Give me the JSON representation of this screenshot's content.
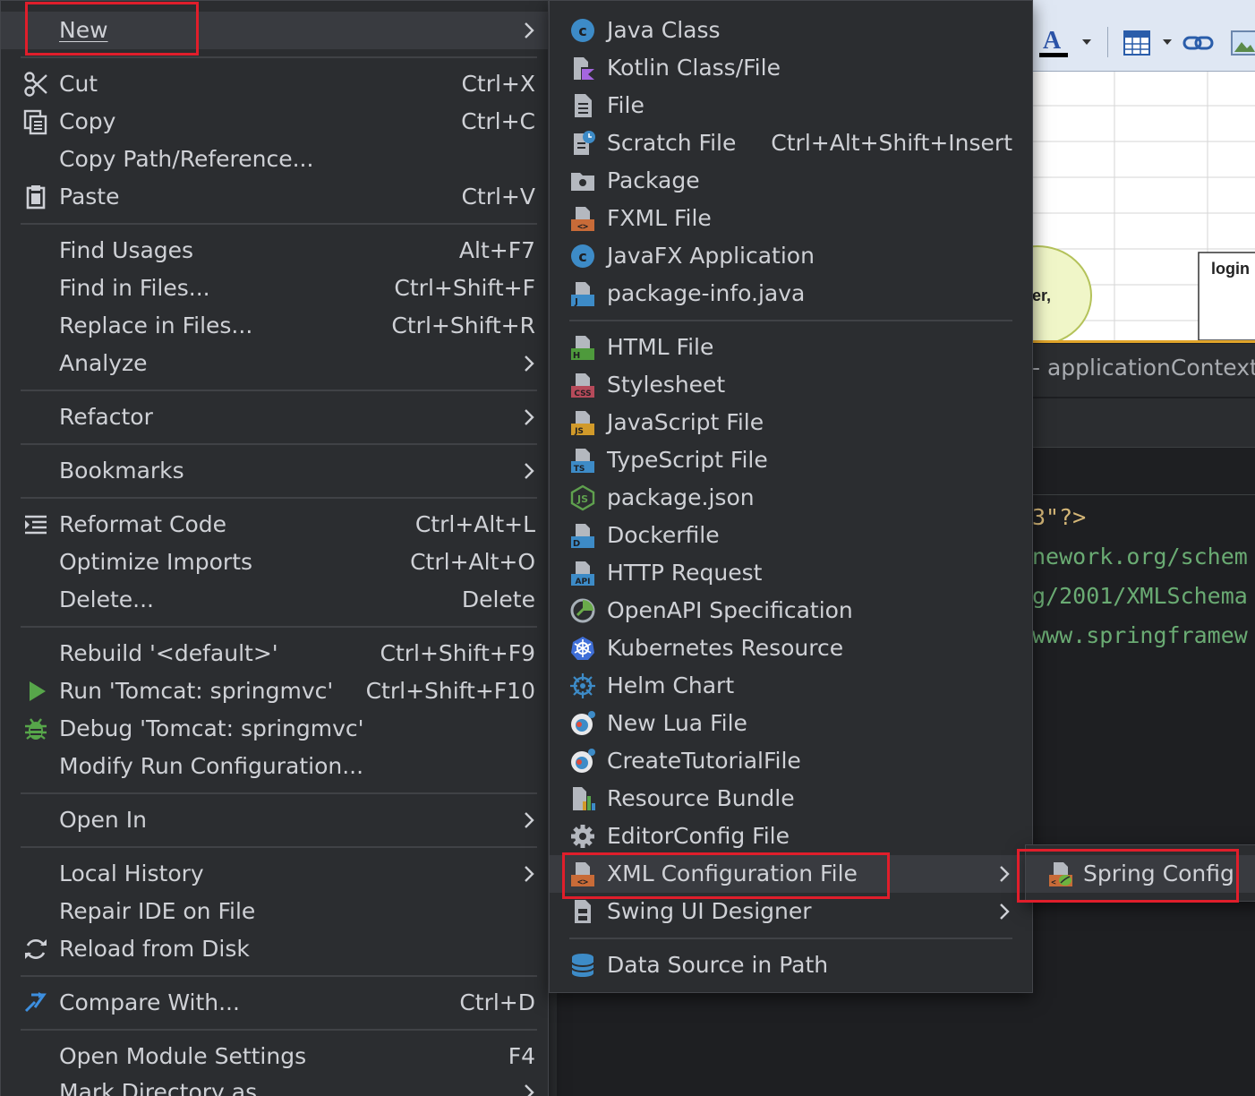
{
  "context_menu": {
    "items": [
      {
        "label": "New",
        "has_submenu": true
      },
      {
        "label": "Cut",
        "shortcut": "Ctrl+X",
        "icon": "scissors-icon"
      },
      {
        "label": "Copy",
        "shortcut": "Ctrl+C",
        "icon": "copy-icon"
      },
      {
        "label": "Copy Path/Reference..."
      },
      {
        "label": "Paste",
        "shortcut": "Ctrl+V",
        "icon": "clipboard-icon"
      },
      {
        "label": "Find Usages",
        "shortcut": "Alt+F7"
      },
      {
        "label": "Find in Files...",
        "shortcut": "Ctrl+Shift+F"
      },
      {
        "label": "Replace in Files...",
        "shortcut": "Ctrl+Shift+R"
      },
      {
        "label": "Analyze",
        "has_submenu": true
      },
      {
        "label": "Refactor",
        "has_submenu": true
      },
      {
        "label": "Bookmarks",
        "has_submenu": true
      },
      {
        "label": "Reformat Code",
        "shortcut": "Ctrl+Alt+L",
        "icon": "reformat-icon"
      },
      {
        "label": "Optimize Imports",
        "shortcut": "Ctrl+Alt+O"
      },
      {
        "label": "Delete...",
        "shortcut": "Delete"
      },
      {
        "label": "Rebuild '<default>'",
        "shortcut": "Ctrl+Shift+F9"
      },
      {
        "label": "Run 'Tomcat: springmvc'",
        "shortcut": "Ctrl+Shift+F10",
        "icon": "run-icon"
      },
      {
        "label": "Debug 'Tomcat: springmvc'",
        "icon": "debug-bug-icon"
      },
      {
        "label": "Modify Run Configuration..."
      },
      {
        "label": "Open In",
        "has_submenu": true
      },
      {
        "label": "Local History",
        "has_submenu": true
      },
      {
        "label": "Repair IDE on File"
      },
      {
        "label": "Reload from Disk",
        "icon": "reload-icon"
      },
      {
        "label": "Compare With...",
        "shortcut": "Ctrl+D",
        "icon": "compare-icon"
      },
      {
        "label": "Open Module Settings",
        "shortcut": "F4"
      },
      {
        "label": "Mark Directory as",
        "has_submenu": true
      }
    ]
  },
  "new_submenu": {
    "items": [
      {
        "label": "Java Class",
        "icon": "java-class-icon"
      },
      {
        "label": "Kotlin Class/File",
        "icon": "kotlin-file-icon"
      },
      {
        "label": "File",
        "icon": "file-icon"
      },
      {
        "label": "Scratch File",
        "shortcut": "Ctrl+Alt+Shift+Insert",
        "icon": "scratch-file-icon"
      },
      {
        "label": "Package",
        "icon": "package-folder-icon"
      },
      {
        "label": "FXML File",
        "icon": "fxml-file-icon"
      },
      {
        "label": "JavaFX Application",
        "icon": "javafx-class-icon"
      },
      {
        "label": "package-info.java",
        "icon": "java-file-icon"
      },
      {
        "label": "HTML File",
        "icon": "html-file-icon"
      },
      {
        "label": "Stylesheet",
        "icon": "css-file-icon"
      },
      {
        "label": "JavaScript File",
        "icon": "js-file-icon"
      },
      {
        "label": "TypeScript File",
        "icon": "ts-file-icon"
      },
      {
        "label": "package.json",
        "icon": "nodejs-icon"
      },
      {
        "label": "Dockerfile",
        "icon": "docker-file-icon"
      },
      {
        "label": "HTTP Request",
        "icon": "api-file-icon"
      },
      {
        "label": "OpenAPI Specification",
        "icon": "openapi-icon"
      },
      {
        "label": "Kubernetes Resource",
        "icon": "kubernetes-icon"
      },
      {
        "label": "Helm Chart",
        "icon": "helm-wheel-icon"
      },
      {
        "label": "New Lua File",
        "icon": "lua-icon"
      },
      {
        "label": "CreateTutorialFile",
        "icon": "lua-icon"
      },
      {
        "label": "Resource Bundle",
        "icon": "resource-bundle-icon"
      },
      {
        "label": "EditorConfig File",
        "icon": "gear-icon"
      },
      {
        "label": "XML Configuration File",
        "icon": "xml-file-icon",
        "has_submenu": true
      },
      {
        "label": "Swing UI Designer",
        "icon": "form-file-icon",
        "has_submenu": true
      },
      {
        "label": "Data Source in Path",
        "icon": "database-icon"
      }
    ]
  },
  "xml_submenu": {
    "items": [
      {
        "label": "Spring Config",
        "icon": "spring-config-icon"
      }
    ]
  },
  "background": {
    "tab_title": "- applicationContext-r",
    "doc_label": "login",
    "doc_oval_text": "er,",
    "code_lines": [
      "3\"?>",
      "nework.org/schem",
      "g/2001/XMLSchema",
      "www.springframew"
    ]
  },
  "colors": {
    "menu_bg": "#2b2d30",
    "highlight_bg": "#393b40",
    "annotation_red": "#e01e2b",
    "xml_attr_green": "#6aab73",
    "xml_decl_orange": "#d5b778"
  }
}
